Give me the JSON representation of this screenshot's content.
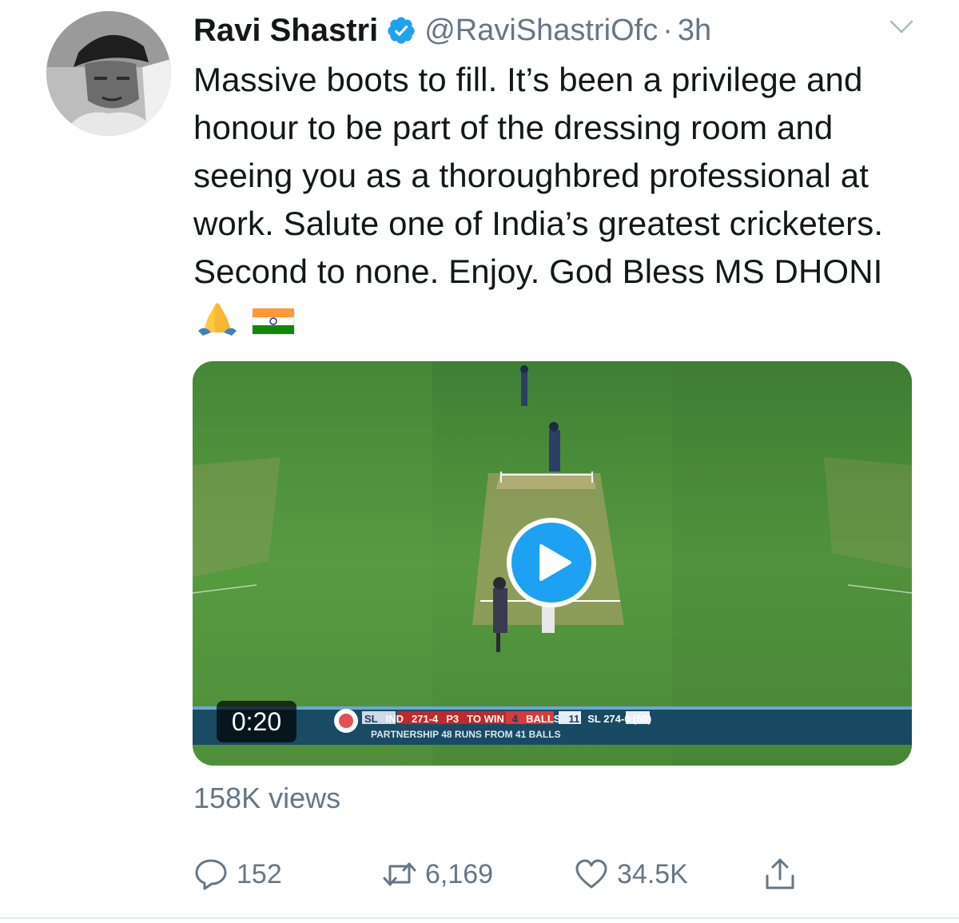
{
  "tweet": {
    "author_name": "Ravi Shastri",
    "handle": "@RaviShastriOfc",
    "separator": "·",
    "timestamp": "3h",
    "text": "Massive boots to fill. It’s been a privilege and honour to be part of the dressing room and seeing you as a thoroughbred professional at work. Salute one of India’s greatest cricketers. Second to none. Enjoy. God Bless MS DHONI",
    "emojis": [
      "🙏",
      "🇮🇳"
    ]
  },
  "video": {
    "duration": "0:20",
    "scoreboard": {
      "team1": "SL",
      "team2": "IND",
      "score": "271-4",
      "code": "P3",
      "to_win_label": "TO WIN",
      "to_win": "4",
      "balls_label": "BALLS",
      "balls": "11",
      "opponent_total": "SL 274-6 (50)",
      "partnership": "PARTNERSHIP 48 RUNS FROM 41 BALLS"
    }
  },
  "stats": {
    "views": "158K views",
    "replies": "152",
    "retweets": "6,169",
    "likes": "34.5K"
  },
  "icons": {
    "verified": "verified-badge-icon",
    "menu": "chevron-down-icon",
    "play": "play-icon",
    "reply": "reply-icon",
    "retweet": "retweet-icon",
    "like": "heart-icon",
    "share": "share-icon"
  },
  "colors": {
    "text": "#14171a",
    "secondary": "#657786",
    "accent": "#1da1f2",
    "divider": "#e6ecf0"
  }
}
